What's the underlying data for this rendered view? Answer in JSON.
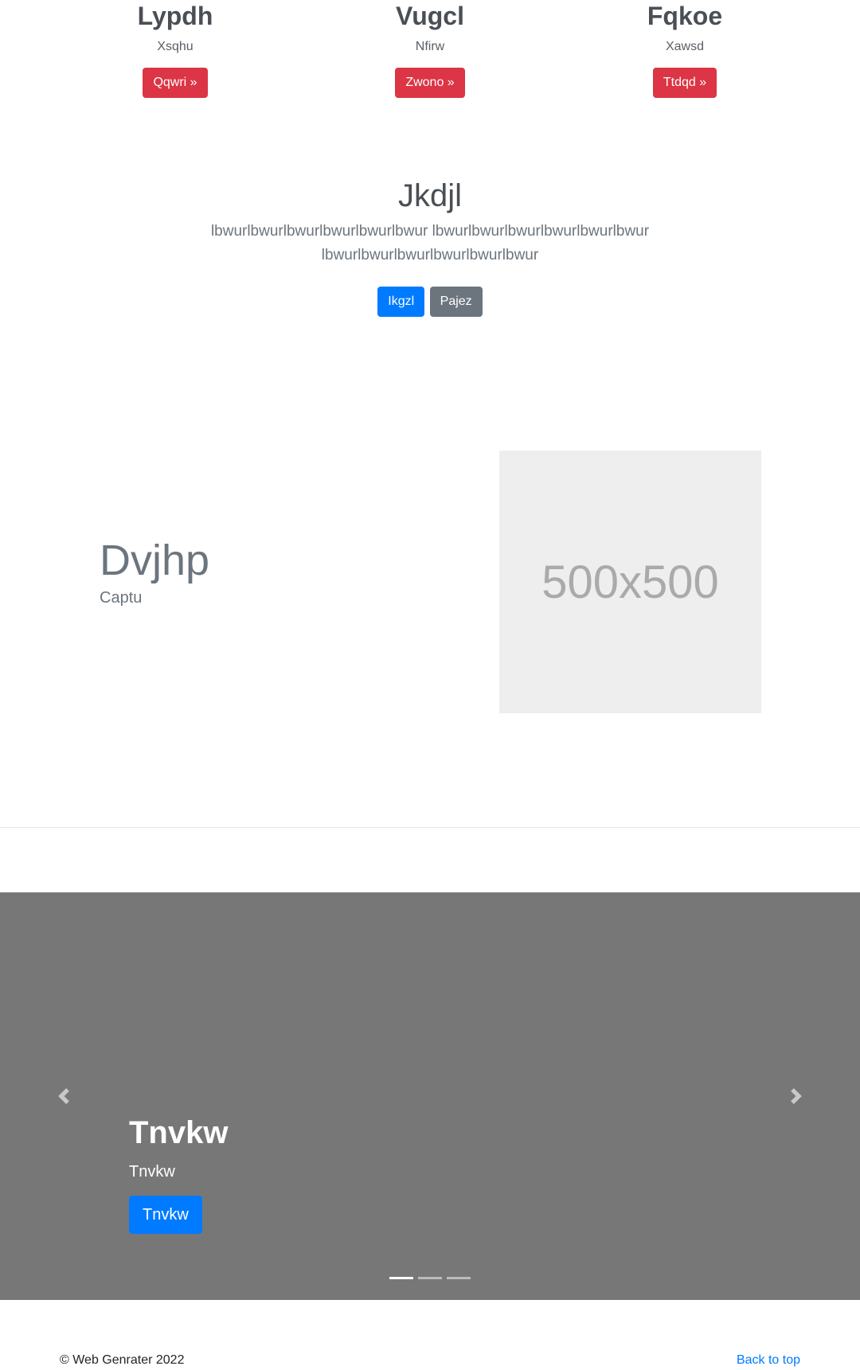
{
  "columns": [
    {
      "title": "Lypdh",
      "subtitle": "Xsqhu",
      "button": "Qqwri »"
    },
    {
      "title": "Vugcl",
      "subtitle": "Nfirw",
      "button": "Zwono »"
    },
    {
      "title": "Fqkoe",
      "subtitle": "Xawsd",
      "button": "Ttdqd »"
    }
  ],
  "hero": {
    "title": "Jkdjl",
    "lead": "lbwurlbwurlbwurlbwurlbwurlbwur lbwurlbwurlbwurlbwurlbwurlbwur lbwurlbwurlbwurlbwurlbwurlbwur",
    "primary_button": "Ikgzl",
    "secondary_button": "Pajez"
  },
  "feature": {
    "heading": "Dvjhp",
    "caption": "Captu",
    "image_label": "500x500"
  },
  "carousel": {
    "title": "Tnvkw",
    "text": "Tnvkw",
    "button": "Tnvkw",
    "prev_icon": "chevron-left-icon",
    "next_icon": "chevron-right-icon",
    "indicator_count": 3,
    "active_index": 0
  },
  "footer": {
    "copyright": "© Web Genrater 2022",
    "back_to_top": "Back to top"
  },
  "colors": {
    "danger": "#dc3545",
    "primary": "#007bff",
    "secondary": "#6c757d",
    "carousel_bg": "#777777",
    "placeholder_bg": "#eeeeee"
  }
}
